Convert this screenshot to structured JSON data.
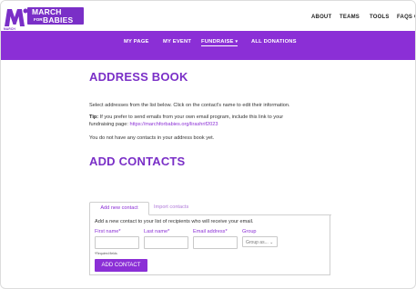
{
  "brand": {
    "line1": "MARCH",
    "line2": "BABIES",
    "for": "FOR",
    "sub": "MARCH OF DIMES",
    "color": "#7a2fc7"
  },
  "topnav": [
    "ABOUT",
    "TEAMS",
    "TOOLS",
    "FAQS",
    "C"
  ],
  "mainnav": {
    "items": [
      "MY PAGE",
      "MY EVENT",
      "FUNDRAISE",
      "ALL DONATIONS"
    ],
    "active": "FUNDRAISE",
    "dropdown_icon": "chevron-down-icon",
    "bar_color": "#8b2fd6"
  },
  "address_book": {
    "title": "ADDRESS BOOK",
    "instruction": "Select addresses from the list below. Click on the contact's name to edit their information.",
    "tip_label": "Tip:",
    "tip_text_1": " If you prefer to send emails from your own email program, include this link to your",
    "tip_text_2": "fundraising page: ",
    "tip_link": "https://marchforbabies.org/lirashrif2023",
    "empty": "You do not have any contacts in your address book yet."
  },
  "add_contacts": {
    "title": "ADD CONTACTS",
    "tabs": [
      "Add new contact",
      "Import contacts"
    ],
    "panel_text": "Add a new contact to your list of recipients who will receive your email.",
    "fields": {
      "first_name": "First name*",
      "last_name": "Last name*",
      "email": "Email address*",
      "group": "Group"
    },
    "group_select": "Group as...",
    "required_note": "*Required fields",
    "button": "ADD CONTACT"
  }
}
